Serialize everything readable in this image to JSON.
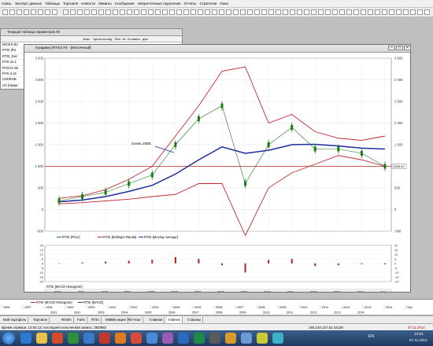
{
  "app": {
    "menu": [
      "Связь",
      "Экспорт данных",
      "Таблицы",
      "Торговля",
      "Новости",
      "Лимиты",
      "Сообщения",
      "Непрочтенные поручения",
      "Отчеты",
      "Стратегии",
      "Окна"
    ]
  },
  "params_window": {
    "title": "Текущая таблица параметров #2",
    "columns": [
      "Знач.",
      "Цена послед.",
      "Рын. кн. % измен.",
      "дня"
    ],
    "rows": [
      "MICEX Ин",
      "RTSI [Ри",
      "RTSI_Dec",
      "RTS-12.1",
      "RTSVX Ин",
      "RTS-3.15",
      "USDRUB",
      "UX [Украи"
    ]
  },
  "chart_window": {
    "title": "Графики [RTSI] #2 - [Месячный]",
    "annotation": "осень 2005",
    "price_tag": "1008.41",
    "legend_main": [
      "RTSI [Price]",
      "RTSI [Bollinger Bands]",
      "RTSI [Moving Average]"
    ],
    "legend_macd": "RTSI [MACD Histogram]",
    "y_ticks_left": [
      "3 500",
      "3 000",
      "2 500",
      "2 000",
      "1 500",
      "1 000",
      "500",
      "0",
      "-500"
    ],
    "y_ticks_right": [
      "3 500",
      "3 000",
      "2 500",
      "2 000",
      "1 500",
      "1 000",
      "500",
      "0",
      "-500"
    ],
    "macd_ticks_left": [
      "20",
      "15",
      "10",
      "5",
      "0",
      "-5",
      "-10",
      "-15",
      "-20"
    ],
    "macd_ticks_right": [
      "20",
      "15",
      "10",
      "5",
      "0",
      "-5",
      "-10",
      "-15",
      "-20"
    ],
    "x_labels": [
      "2001",
      "2002",
      "2003",
      "2004",
      "2005",
      "2006",
      "2007",
      "2008",
      "2009",
      "2010",
      "2011",
      "2012",
      "2013",
      "2014",
      "Sep"
    ],
    "colors": {
      "price": "#1a7a1a",
      "bollinger": "#c0272d",
      "ma": "#1c2d9e",
      "macd": "#b22222",
      "level_line": "#c0272d"
    }
  },
  "bottom_pane": {
    "legend": [
      "RTSI [MACD Histogram]",
      "RTSI [MACD]"
    ],
    "years_top": [
      "1995",
      "1997",
      "1998",
      "1999",
      "2000",
      "2001",
      "2002",
      "2003",
      "2004",
      "2005",
      "2006",
      "2007",
      "2008",
      "2009",
      "2010",
      "2011",
      "2012",
      "2013",
      "2014",
      "Sep"
    ],
    "years_bottom": [
      "2001",
      "2002",
      "2003",
      "2004",
      "2005",
      "2006",
      "2007",
      "2008",
      "2009",
      "2010",
      "2011",
      "2012",
      "2013",
      "2014"
    ]
  },
  "tabs": [
    "Мой портфель",
    "Торговля",
    "RGMA",
    "Farts",
    "RTSI",
    "MMBB-акции",
    "RE-Hour",
    "Главная",
    "Indexes",
    "Стаканы"
  ],
  "status": {
    "text": "Время сервера: 13:54:13; последняя полученная запись: 382/882",
    "ip": "193.219.127.51:15100",
    "date": "07.11.2014"
  },
  "taskbar": {
    "lang": "EN",
    "time": "13:54",
    "date": "07.11.2014"
  },
  "chart_data": {
    "type": "line",
    "title": "Графики [RTSI] #2 - [Месячный]",
    "x": [
      "2001",
      "2002",
      "2003",
      "2004",
      "2005",
      "2006",
      "2007",
      "2008",
      "2009",
      "2010",
      "2011",
      "2012",
      "2013",
      "2014",
      "2014-Sep"
    ],
    "series": [
      {
        "name": "RTSI [Price]",
        "values": [
          200,
          300,
          400,
          600,
          800,
          1500,
          2100,
          2400,
          600,
          1500,
          1900,
          1400,
          1400,
          1300,
          1000
        ]
      },
      {
        "name": "RTSI [Moving Average]",
        "values": [
          180,
          220,
          300,
          420,
          560,
          820,
          1150,
          1450,
          1300,
          1370,
          1500,
          1510,
          1470,
          1420,
          1400
        ]
      },
      {
        "name": "RTSI [Bollinger Bands] upper",
        "values": [
          260,
          320,
          460,
          700,
          1000,
          1700,
          2400,
          3200,
          3300,
          2000,
          2200,
          1800,
          1650,
          1600,
          1700
        ]
      },
      {
        "name": "RTSI [Bollinger Bands] lower",
        "values": [
          130,
          160,
          200,
          240,
          300,
          350,
          600,
          600,
          -600,
          500,
          850,
          1050,
          1250,
          1150,
          1000
        ]
      }
    ],
    "ylim": [
      -500,
      3500
    ],
    "grid": true,
    "reference_line": 1000,
    "macd_histogram": {
      "name": "RTSI [MACD Histogram]",
      "ylim": [
        -20,
        20
      ],
      "x": [
        "2001",
        "2002",
        "2003",
        "2004",
        "2005",
        "2006",
        "2007",
        "2008",
        "2009",
        "2010",
        "2011",
        "2012",
        "2013",
        "2014",
        "2014-Sep"
      ],
      "values": [
        0,
        1,
        2,
        3,
        4,
        7,
        5,
        -2,
        -10,
        4,
        5,
        -3,
        -2,
        -1,
        -1
      ]
    }
  }
}
